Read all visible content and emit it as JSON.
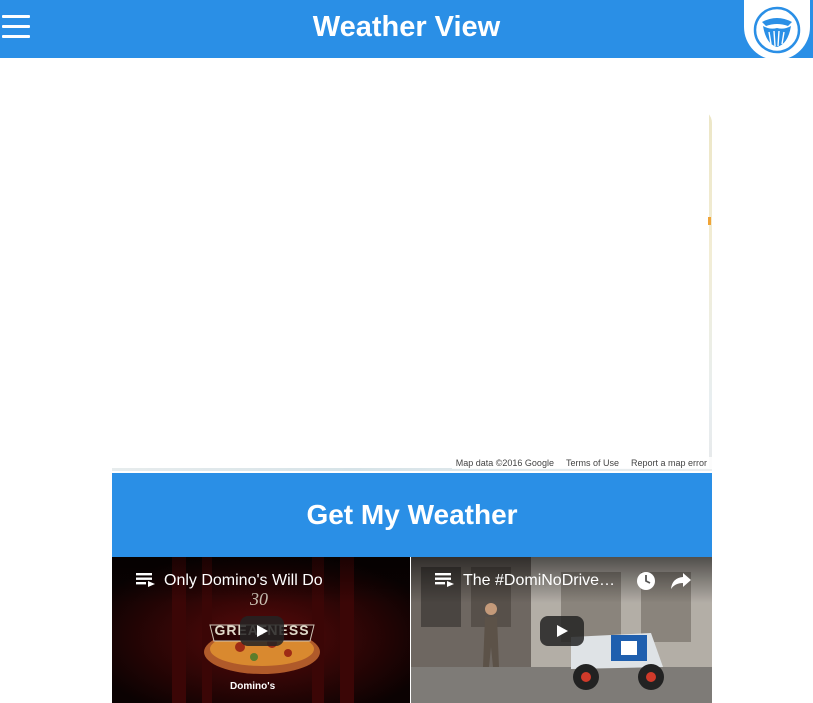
{
  "header": {
    "title": "Weather View",
    "menu_icon": "hamburger-menu-icon",
    "logo_icon": "owl-logo-icon",
    "bg_color": "#2a8fe6"
  },
  "map": {
    "attribution": {
      "data": "Map data ©2016 Google",
      "terms": "Terms of Use",
      "report": "Report a map error"
    }
  },
  "action": {
    "get_weather_label": "Get My Weather",
    "bg_color": "#2a8fe6"
  },
  "videos": [
    {
      "title": "Only Domino's Will Do",
      "thumb_text": "30",
      "thumb_banner": "GREATNESS",
      "thumb_brand": "Domino's",
      "icons": [
        "playlist-icon",
        "play-icon"
      ]
    },
    {
      "title": "The #DomiNoDrive…",
      "icons": [
        "playlist-icon",
        "clock-icon",
        "share-icon",
        "play-icon"
      ]
    }
  ]
}
